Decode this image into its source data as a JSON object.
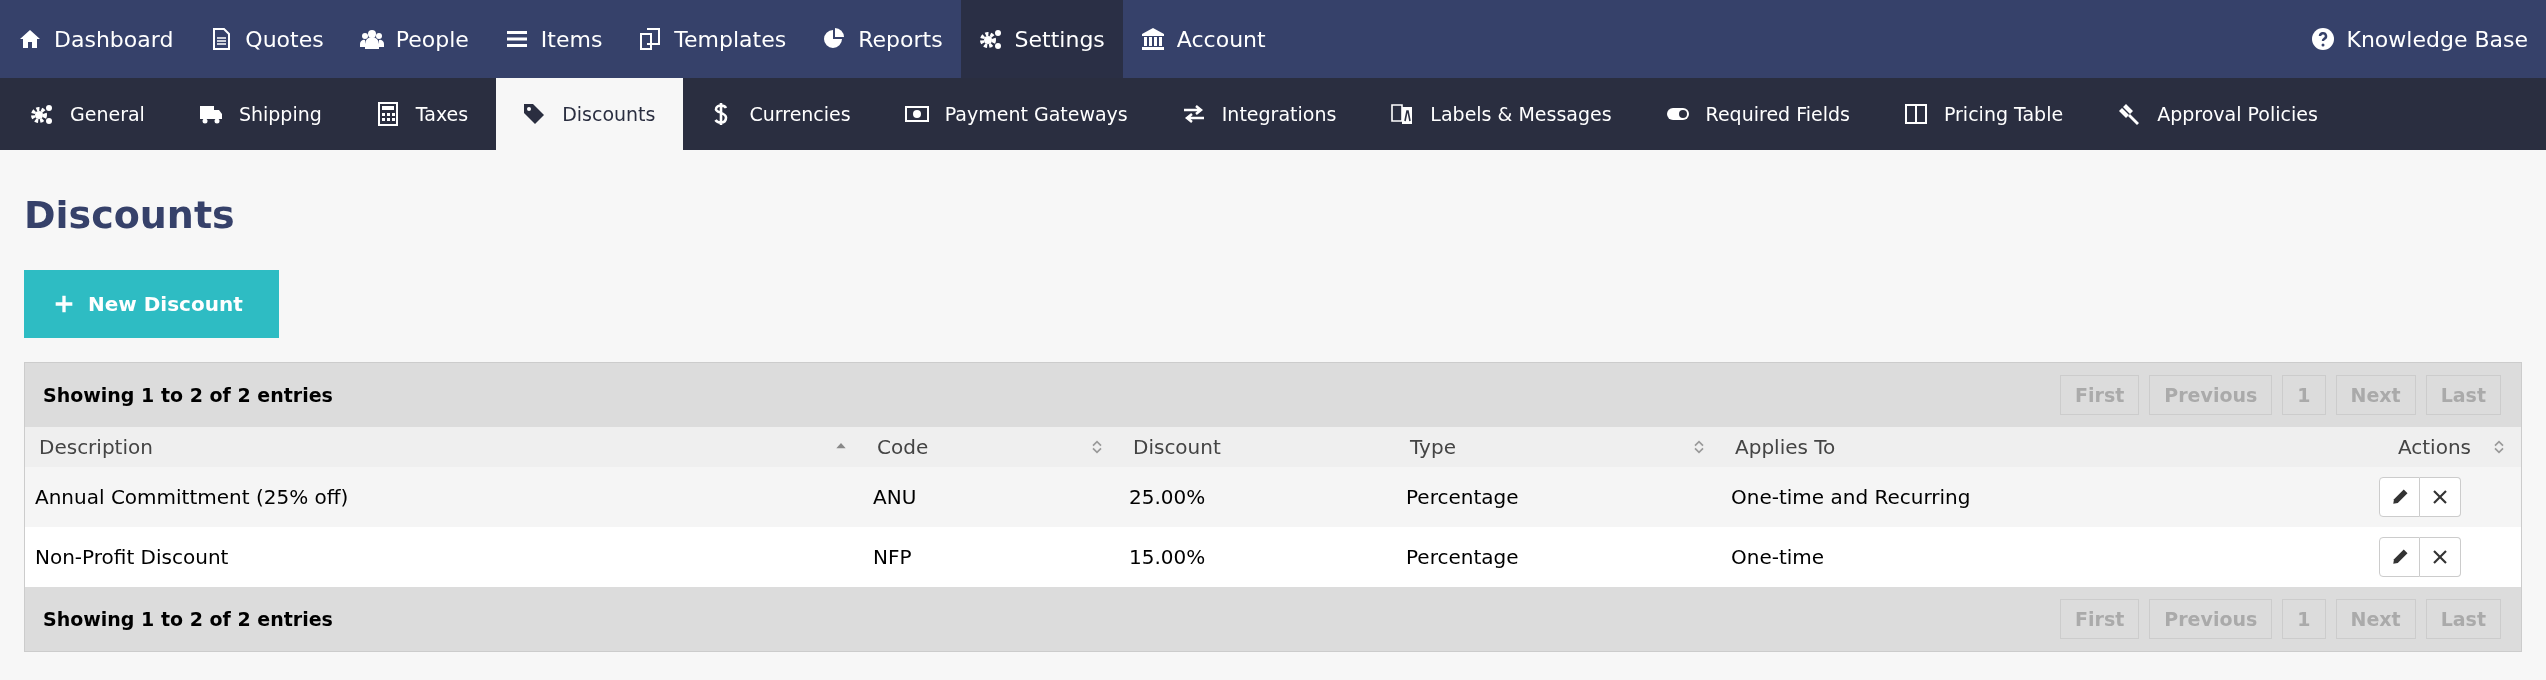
{
  "top_nav": {
    "items": [
      {
        "label": "Dashboard",
        "selected": false
      },
      {
        "label": "Quotes",
        "selected": false
      },
      {
        "label": "People",
        "selected": false
      },
      {
        "label": "Items",
        "selected": false
      },
      {
        "label": "Templates",
        "selected": false
      },
      {
        "label": "Reports",
        "selected": false
      },
      {
        "label": "Settings",
        "selected": true
      },
      {
        "label": "Account",
        "selected": false
      }
    ],
    "help_link": "Knowledge Base"
  },
  "sub_nav": {
    "items": [
      {
        "label": "General",
        "selected": false
      },
      {
        "label": "Shipping",
        "selected": false
      },
      {
        "label": "Taxes",
        "selected": false
      },
      {
        "label": "Discounts",
        "selected": true
      },
      {
        "label": "Currencies",
        "selected": false
      },
      {
        "label": "Payment Gateways",
        "selected": false
      },
      {
        "label": "Integrations",
        "selected": false
      },
      {
        "label": "Labels & Messages",
        "selected": false
      },
      {
        "label": "Required Fields",
        "selected": false
      },
      {
        "label": "Pricing Table",
        "selected": false
      },
      {
        "label": "Approval Policies",
        "selected": false
      }
    ]
  },
  "page_title": "Discounts",
  "new_button": "New Discount",
  "table": {
    "info_top": "Showing 1 to 2 of 2 entries",
    "pagination_top": [
      {
        "label": "First",
        "disabled": true
      },
      {
        "label": "Previous",
        "disabled": true
      },
      {
        "label": "1",
        "disabled": true
      },
      {
        "label": "Next",
        "disabled": true
      },
      {
        "label": "Last",
        "disabled": true
      }
    ],
    "columns": [
      {
        "label": "Description",
        "sortable": true,
        "sorted": true
      },
      {
        "label": "Code",
        "sortable": true,
        "sorted": false
      },
      {
        "label": "Discount",
        "sortable": false,
        "sorted": false
      },
      {
        "label": "Type",
        "sortable": true,
        "sorted": false
      },
      {
        "label": "Applies To",
        "sortable": false,
        "sorted": false
      },
      {
        "label": "Actions",
        "sortable": true,
        "sorted": false
      }
    ],
    "rows": [
      {
        "cells": [
          "Annual Committment (25% off)",
          "ANU",
          "25.00%",
          "Percentage",
          "One-time and Recurring"
        ]
      },
      {
        "cells": [
          "Non-Profit Discount",
          "NFP",
          "15.00%",
          "Percentage",
          "One-time"
        ]
      }
    ],
    "info_bottom": "Showing 1 to 2 of 2 entries",
    "pagination_bottom": [
      {
        "label": "First",
        "disabled": true
      },
      {
        "label": "Previous",
        "disabled": true
      },
      {
        "label": "1",
        "disabled": true
      },
      {
        "label": "Next",
        "disabled": true
      },
      {
        "label": "Last",
        "disabled": true
      }
    ]
  }
}
